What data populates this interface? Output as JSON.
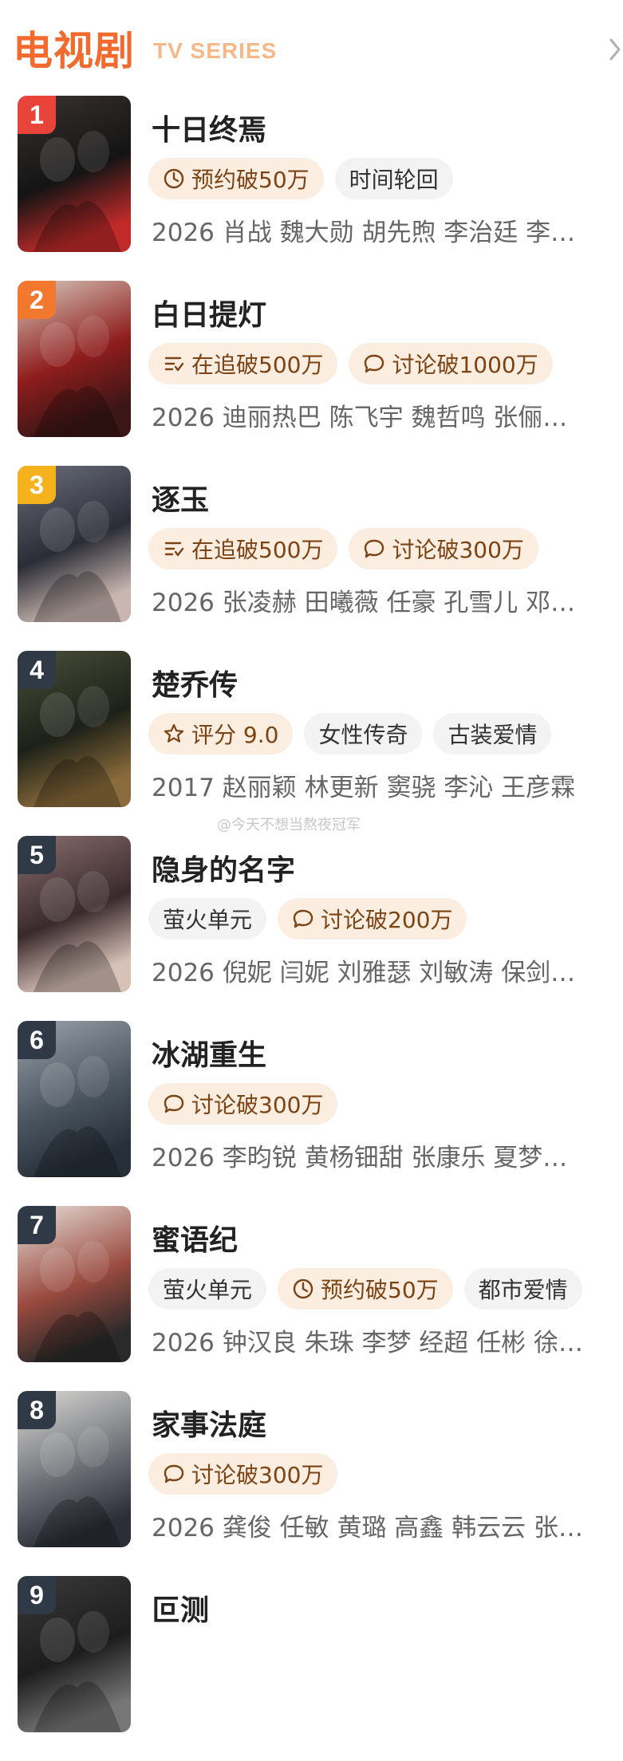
{
  "header": {
    "title": "电视剧",
    "subtitle": "TV SERIES"
  },
  "watermark": "@今天不想当熬夜冠军",
  "rank_colors": {
    "1": "#e8443a",
    "2": "#f2782f",
    "3": "#f5b21c",
    "other": "#303a46"
  },
  "items": [
    {
      "rank": "1",
      "title": "十日终焉",
      "tags": [
        {
          "icon": "clock-icon",
          "text": "预约破50万",
          "style": "hot"
        },
        {
          "text": "时间轮回",
          "style": "plain"
        }
      ],
      "meta": "2026 肖战 魏大勋 胡先煦 李治廷 李…"
    },
    {
      "rank": "2",
      "title": "白日提灯",
      "tags": [
        {
          "icon": "list-icon",
          "text": "在追破500万",
          "style": "hot"
        },
        {
          "icon": "chat-icon",
          "text": "讨论破1000万",
          "style": "hot"
        }
      ],
      "meta": "2026 迪丽热巴 陈飞宇 魏哲鸣 张俪…"
    },
    {
      "rank": "3",
      "title": "逐玉",
      "tags": [
        {
          "icon": "list-icon",
          "text": "在追破500万",
          "style": "hot"
        },
        {
          "icon": "chat-icon",
          "text": "讨论破300万",
          "style": "hot"
        }
      ],
      "meta": "2026 张凌赫 田曦薇 任豪 孔雪儿 邓…"
    },
    {
      "rank": "4",
      "title": "楚乔传",
      "tags": [
        {
          "icon": "star-icon",
          "text": "评分 9.0",
          "style": "hot"
        },
        {
          "text": "女性传奇",
          "style": "plain"
        },
        {
          "text": "古装爱情",
          "style": "plain"
        }
      ],
      "meta": "2017 赵丽颖 林更新 窦骁 李沁 王彦霖"
    },
    {
      "rank": "5",
      "title": "隐身的名字",
      "tags": [
        {
          "text": "萤火单元",
          "style": "plain"
        },
        {
          "icon": "chat-icon",
          "text": "讨论破200万",
          "style": "hot"
        }
      ],
      "meta": "2026 倪妮 闫妮 刘雅瑟 刘敏涛 保剑…"
    },
    {
      "rank": "6",
      "title": "冰湖重生",
      "tags": [
        {
          "icon": "chat-icon",
          "text": "讨论破300万",
          "style": "hot"
        }
      ],
      "meta": "2026 李昀锐 黄杨钿甜 张康乐 夏梦…"
    },
    {
      "rank": "7",
      "title": "蜜语纪",
      "tags": [
        {
          "text": "萤火单元",
          "style": "plain"
        },
        {
          "icon": "clock-icon",
          "text": "预约破50万",
          "style": "hot"
        },
        {
          "text": "都市爱情",
          "style": "plain"
        }
      ],
      "meta": "2026 钟汉良 朱珠 李梦 经超 任彬 徐…"
    },
    {
      "rank": "8",
      "title": "家事法庭",
      "tags": [
        {
          "icon": "chat-icon",
          "text": "讨论破300万",
          "style": "hot"
        }
      ],
      "meta": "2026 龚俊 任敏 黄璐 高鑫 韩云云 张…"
    },
    {
      "rank": "9",
      "title": "叵测",
      "tags": [],
      "meta": ""
    }
  ]
}
